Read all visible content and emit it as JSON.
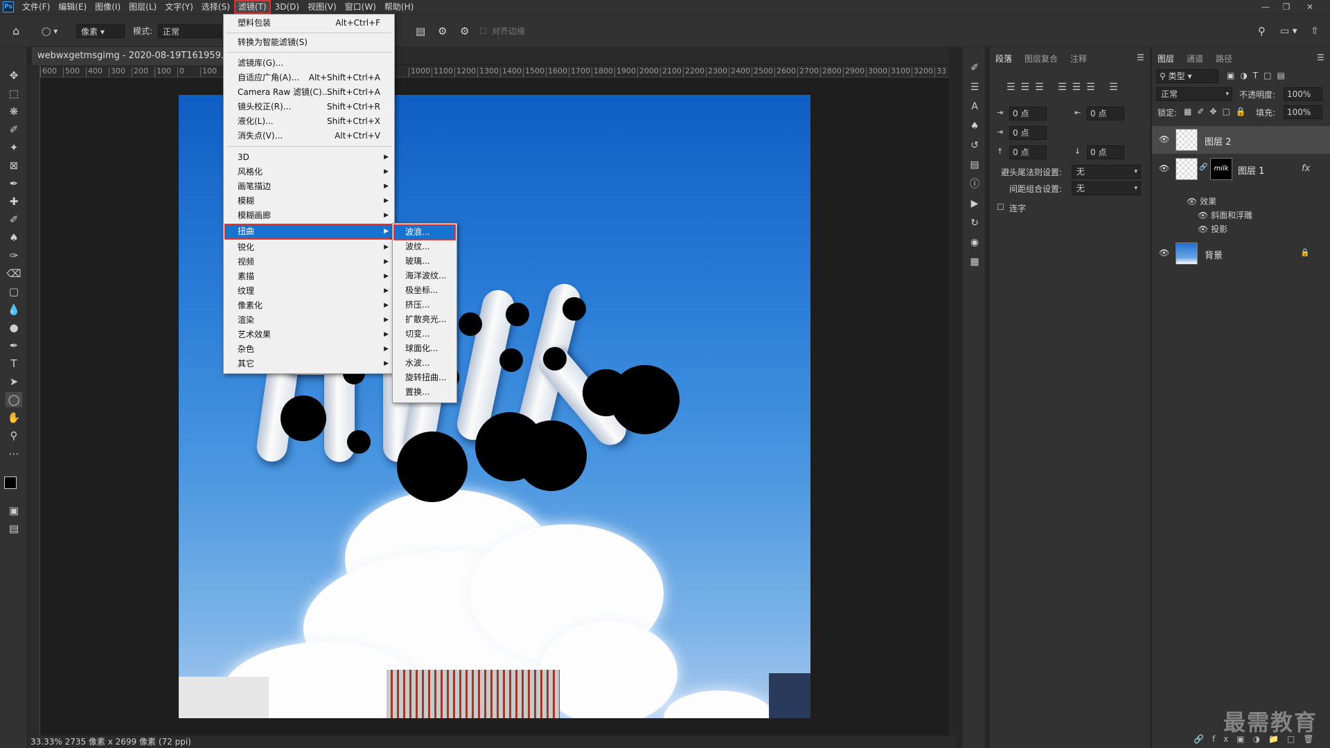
{
  "menubar": {
    "logo": "Ps",
    "items": [
      "文件(F)",
      "编辑(E)",
      "图像(I)",
      "图层(L)",
      "文字(Y)",
      "选择(S)",
      "滤镜(T)",
      "3D(D)",
      "视图(V)",
      "窗口(W)",
      "帮助(H)"
    ],
    "active": "滤镜(T)"
  },
  "options": {
    "unit": "像素",
    "mode_label": "模式:",
    "mode_value": "正常",
    "align_edges": "对齐边缘"
  },
  "document": {
    "tab_title": "webwxgetmsgimg - 2020-08-19T161959.022.jpg"
  },
  "ruler": {
    "left_ticks": [
      "600",
      "500",
      "400",
      "300",
      "200",
      "100",
      "0",
      "100"
    ],
    "right_ticks": [
      "1000",
      "1100",
      "1200",
      "1300",
      "1400",
      "1500",
      "1600",
      "1700",
      "1800",
      "1900",
      "2000",
      "2100",
      "2200",
      "2300",
      "2400",
      "2500",
      "2600",
      "2700",
      "2800",
      "2900",
      "3000",
      "3100",
      "3200",
      "33"
    ]
  },
  "status": {
    "text": "33.33%  2735 像素 x 2699 像素 (72 ppi)"
  },
  "filter_menu": {
    "items": [
      {
        "label": "塑料包装",
        "shortcut": "Alt+Ctrl+F"
      },
      {
        "label": "转换为智能滤镜(S)",
        "shortcut": ""
      },
      {
        "label": "滤镜库(G)...",
        "shortcut": ""
      },
      {
        "label": "自适应广角(A)...",
        "shortcut": "Alt+Shift+Ctrl+A"
      },
      {
        "label": "Camera Raw 滤镜(C)...",
        "shortcut": "Shift+Ctrl+A"
      },
      {
        "label": "镜头校正(R)...",
        "shortcut": "Shift+Ctrl+R"
      },
      {
        "label": "液化(L)...",
        "shortcut": "Shift+Ctrl+X"
      },
      {
        "label": "消失点(V)...",
        "shortcut": "Alt+Ctrl+V"
      },
      {
        "label": "3D",
        "shortcut": ""
      },
      {
        "label": "风格化",
        "shortcut": ""
      },
      {
        "label": "画笔描边",
        "shortcut": ""
      },
      {
        "label": "模糊",
        "shortcut": ""
      },
      {
        "label": "模糊画廊",
        "shortcut": ""
      },
      {
        "label": "扭曲",
        "shortcut": ""
      },
      {
        "label": "锐化",
        "shortcut": ""
      },
      {
        "label": "视频",
        "shortcut": ""
      },
      {
        "label": "素描",
        "shortcut": ""
      },
      {
        "label": "纹理",
        "shortcut": ""
      },
      {
        "label": "像素化",
        "shortcut": ""
      },
      {
        "label": "渲染",
        "shortcut": ""
      },
      {
        "label": "艺术效果",
        "shortcut": ""
      },
      {
        "label": "杂色",
        "shortcut": ""
      },
      {
        "label": "其它",
        "shortcut": ""
      }
    ],
    "highlighted": "扭曲"
  },
  "distort_submenu": {
    "items": [
      "波浪...",
      "波纹...",
      "玻璃...",
      "海洋波纹...",
      "极坐标...",
      "挤压...",
      "扩散亮光...",
      "切变...",
      "球面化...",
      "水波...",
      "旋转扭曲...",
      "置换..."
    ],
    "highlighted": "波浪..."
  },
  "paragraph_panel": {
    "tabs": [
      "段落",
      "图层复合",
      "注释"
    ],
    "indent_left": "0 点",
    "indent_right": "0 点",
    "indent_first": "0 点",
    "space_before": "0 点",
    "space_after": "0 点",
    "hyphen_label": "避头尾法则设置:",
    "hyphen_value": "无",
    "spacing_label": "间距组合设置:",
    "spacing_value": "无",
    "hyphenate_label": "连字"
  },
  "layers_panel": {
    "tabs": [
      "图层",
      "通道",
      "路径"
    ],
    "filter_type": "类型",
    "blend_mode": "正常",
    "opacity_label": "不透明度:",
    "opacity_value": "100%",
    "lock_label": "锁定:",
    "fill_label": "填充:",
    "fill_value": "100%",
    "layers": [
      {
        "name": "图层 2"
      },
      {
        "name": "图层 1",
        "mask_text": "milk",
        "fx": "fx"
      },
      {
        "name": "背景"
      }
    ],
    "effects_label": "效果",
    "effect_items": [
      "斜面和浮雕",
      "投影"
    ]
  },
  "watermark": "最需教育",
  "colors": {
    "accent_highlight": "#1673cf",
    "red_outline": "#e03030",
    "sky": "#2c7fd8"
  }
}
